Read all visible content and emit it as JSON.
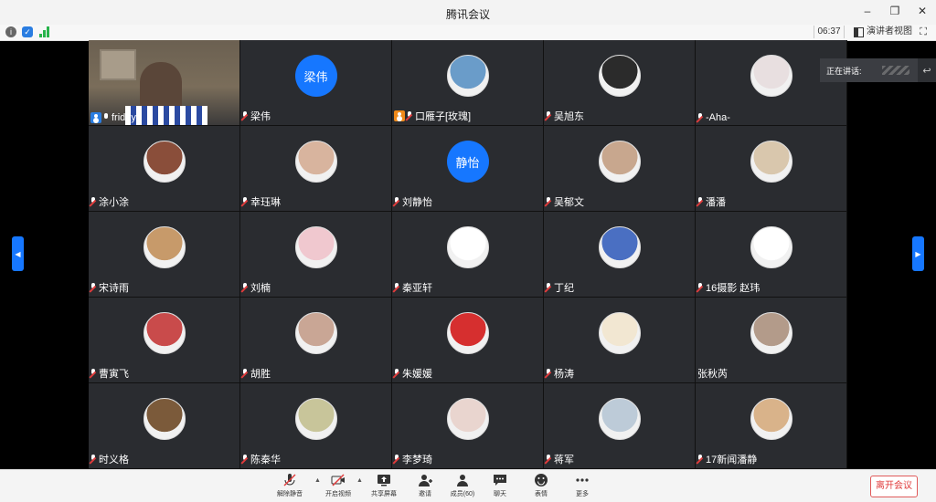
{
  "window": {
    "title": "腾讯会议",
    "controls": {
      "minimize": "–",
      "restore": "❐",
      "close": "✕"
    }
  },
  "infobar": {
    "time": "06:37",
    "speaker_view_label": "演讲者视图",
    "fullscreen_icon": "⛶"
  },
  "speaking": {
    "label": "正在讲话:"
  },
  "participants": [
    {
      "name": "friday",
      "avatar": "video",
      "badge": "host",
      "mic": "on"
    },
    {
      "name": "梁伟",
      "avatar": "text",
      "avatar_text": "梁伟",
      "mic": "muted"
    },
    {
      "name": "口雁子[玫瑰]",
      "avatar": "photo",
      "color": "#6a9cc9",
      "badge": "cohost",
      "mic": "muted"
    },
    {
      "name": "吴旭东",
      "avatar": "photo",
      "color": "#2b2b2b",
      "mic": "muted"
    },
    {
      "name": "-Aha-",
      "avatar": "photo",
      "color": "#e8dfe0",
      "mic": "muted"
    },
    {
      "name": "涂小涂",
      "avatar": "photo",
      "color": "#8a4e3a",
      "mic": "muted"
    },
    {
      "name": "幸珏琳",
      "avatar": "photo",
      "color": "#d8b49e",
      "mic": "muted"
    },
    {
      "name": "刘静怡",
      "avatar": "text",
      "avatar_text": "静怡",
      "mic": "muted"
    },
    {
      "name": "吴郁文",
      "avatar": "photo",
      "color": "#c8a78e",
      "mic": "muted"
    },
    {
      "name": "潘潘",
      "avatar": "photo",
      "color": "#d9c7ad",
      "mic": "muted"
    },
    {
      "name": "宋诗雨",
      "avatar": "photo",
      "color": "#c79a6a",
      "mic": "muted"
    },
    {
      "name": "刘楠",
      "avatar": "photo",
      "color": "#f0c8cf",
      "mic": "muted"
    },
    {
      "name": "秦亚轩",
      "avatar": "photo",
      "color": "#ffffff",
      "mic": "muted"
    },
    {
      "name": "丁纪",
      "avatar": "photo",
      "color": "#4a6fc2",
      "mic": "muted"
    },
    {
      "name": "16摄影 赵玮",
      "avatar": "photo",
      "color": "#ffffff",
      "mic": "muted"
    },
    {
      "name": "曹寅飞",
      "avatar": "photo",
      "color": "#c94b4b",
      "mic": "muted"
    },
    {
      "name": "胡胜",
      "avatar": "photo",
      "color": "#c9a695",
      "mic": "muted"
    },
    {
      "name": "朱媛媛",
      "avatar": "photo",
      "color": "#d62f2f",
      "mic": "muted"
    },
    {
      "name": "杨涛",
      "avatar": "photo",
      "color": "#f2e7d2",
      "mic": "muted"
    },
    {
      "name": "张秋芮",
      "avatar": "photo",
      "color": "#b39b8a",
      "mic": "none"
    },
    {
      "name": "时义格",
      "avatar": "photo",
      "color": "#7b5a3a",
      "mic": "muted"
    },
    {
      "name": "陈秦华",
      "avatar": "photo",
      "color": "#c8c59a",
      "mic": "muted"
    },
    {
      "name": "李梦琦",
      "avatar": "photo",
      "color": "#e9d5cf",
      "mic": "muted"
    },
    {
      "name": "蒋军",
      "avatar": "photo",
      "color": "#bdcbd8",
      "mic": "muted"
    },
    {
      "name": "17新闻潘静",
      "avatar": "photo",
      "color": "#d9b38a",
      "mic": "muted"
    }
  ],
  "toolbar": {
    "unmute": "解除静音",
    "start_video": "开启视频",
    "share_screen": "共享屏幕",
    "invite": "邀请",
    "members": "成员(60)",
    "chat": "聊天",
    "reactions": "表情",
    "more": "更多",
    "leave": "离开会议"
  }
}
